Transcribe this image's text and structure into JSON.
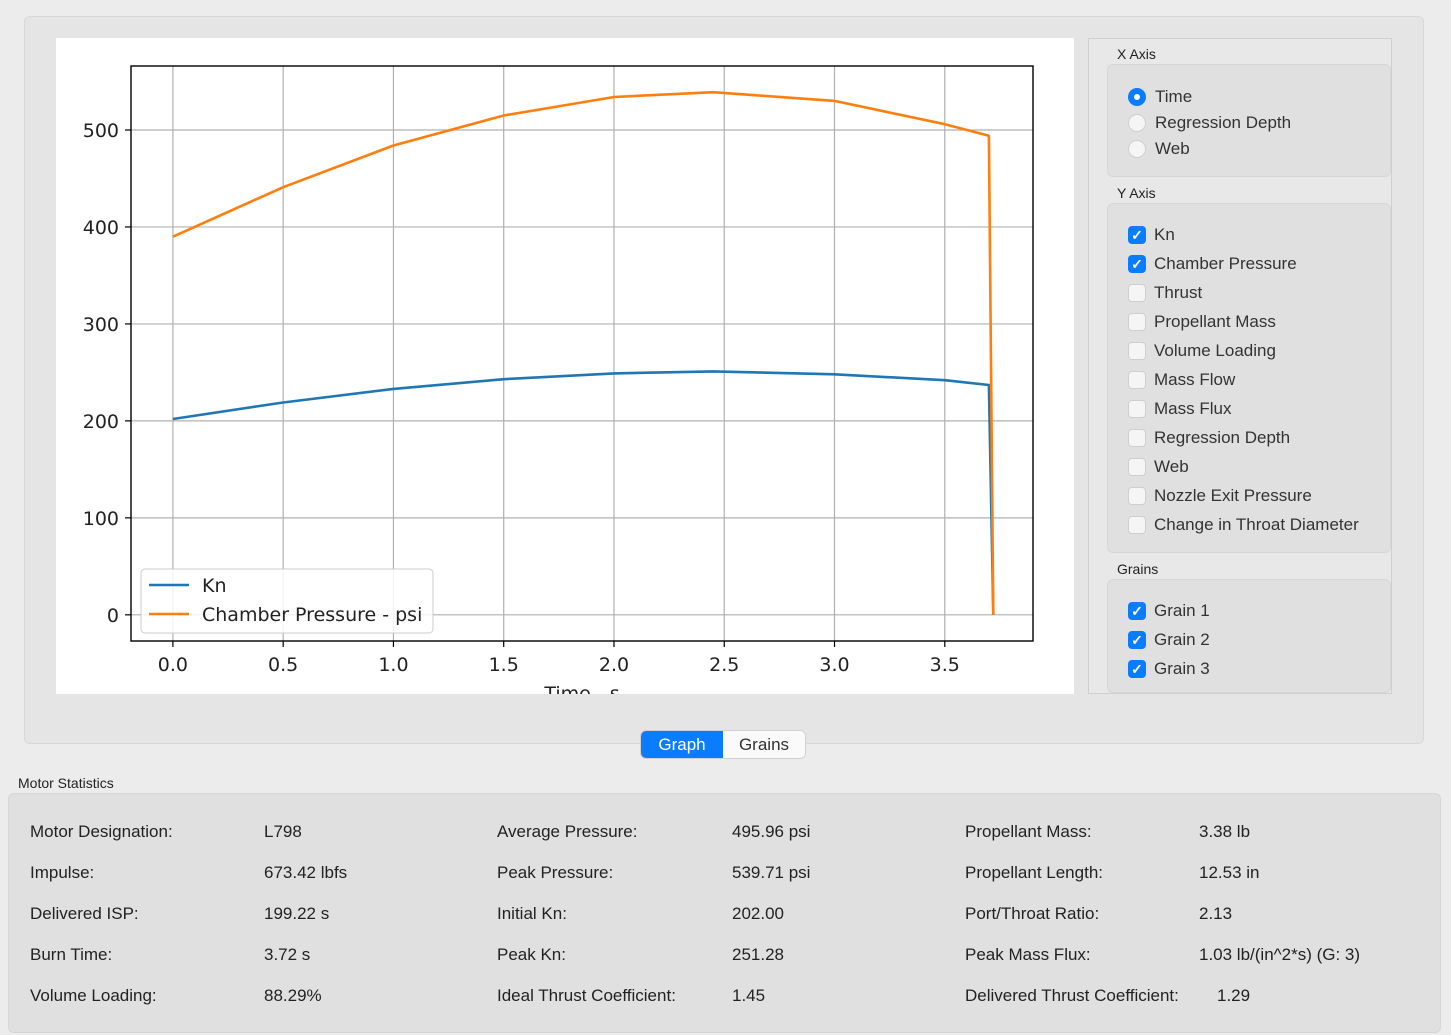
{
  "x_axis": {
    "title": "X Axis",
    "options": [
      {
        "label": "Time",
        "selected": true
      },
      {
        "label": "Regression Depth",
        "selected": false
      },
      {
        "label": "Web",
        "selected": false
      }
    ]
  },
  "y_axis": {
    "title": "Y Axis",
    "options": [
      {
        "label": "Kn",
        "checked": true
      },
      {
        "label": "Chamber Pressure",
        "checked": true
      },
      {
        "label": "Thrust",
        "checked": false
      },
      {
        "label": "Propellant Mass",
        "checked": false
      },
      {
        "label": "Volume Loading",
        "checked": false
      },
      {
        "label": "Mass Flow",
        "checked": false
      },
      {
        "label": "Mass Flux",
        "checked": false
      },
      {
        "label": "Regression Depth",
        "checked": false
      },
      {
        "label": "Web",
        "checked": false
      },
      {
        "label": "Nozzle Exit Pressure",
        "checked": false
      },
      {
        "label": "Change in Throat Diameter",
        "checked": false
      }
    ]
  },
  "grains": {
    "title": "Grains",
    "options": [
      {
        "label": "Grain 1",
        "checked": true
      },
      {
        "label": "Grain 2",
        "checked": true
      },
      {
        "label": "Grain 3",
        "checked": true
      }
    ]
  },
  "tabs": [
    {
      "label": "Graph",
      "active": true
    },
    {
      "label": "Grains",
      "active": false
    }
  ],
  "stats": {
    "title": "Motor Statistics",
    "columns": [
      [
        {
          "label": "Motor Designation:",
          "value": "L798"
        },
        {
          "label": "Impulse:",
          "value": "673.42 lbfs"
        },
        {
          "label": "Delivered ISP:",
          "value": "199.22 s"
        },
        {
          "label": "Burn Time:",
          "value": "3.72 s"
        },
        {
          "label": "Volume Loading:",
          "value": "88.29%"
        }
      ],
      [
        {
          "label": "Average Pressure:",
          "value": "495.96 psi"
        },
        {
          "label": "Peak Pressure:",
          "value": "539.71 psi"
        },
        {
          "label": "Initial Kn:",
          "value": "202.00"
        },
        {
          "label": "Peak Kn:",
          "value": "251.28"
        },
        {
          "label": "Ideal Thrust Coefficient:",
          "value": "1.45"
        }
      ],
      [
        {
          "label": "Propellant Mass:",
          "value": "3.38 lb"
        },
        {
          "label": "Propellant Length:",
          "value": "12.53 in"
        },
        {
          "label": "Port/Throat Ratio:",
          "value": "2.13"
        },
        {
          "label": "Peak Mass Flux:",
          "value": "1.03 lb/(in^2*s) (G: 3)"
        },
        {
          "label": "Delivered Thrust Coefficient:",
          "value": "1.29"
        }
      ]
    ]
  },
  "chart_data": {
    "type": "line",
    "xlabel": "Time - s",
    "ylabel": "",
    "xlim": [
      -0.19,
      3.9
    ],
    "ylim": [
      -27,
      566
    ],
    "xticks": [
      0.0,
      0.5,
      1.0,
      1.5,
      2.0,
      2.5,
      3.0,
      3.5
    ],
    "yticks": [
      0,
      100,
      200,
      300,
      400,
      500
    ],
    "grid": true,
    "legend_position": "lower-left",
    "series": [
      {
        "name": "Kn",
        "color": "#1f77b4",
        "x": [
          0.0,
          0.5,
          1.0,
          1.5,
          2.0,
          2.45,
          3.0,
          3.5,
          3.7,
          3.72
        ],
        "y": [
          202,
          219,
          233,
          243,
          249,
          251,
          248,
          242,
          237,
          0
        ]
      },
      {
        "name": "Chamber Pressure - psi",
        "color": "#ff7f0e",
        "x": [
          0.0,
          0.5,
          1.0,
          1.5,
          2.0,
          2.45,
          3.0,
          3.5,
          3.7,
          3.72
        ],
        "y": [
          390,
          441,
          484,
          515,
          534,
          539,
          530,
          506,
          494,
          0
        ]
      }
    ]
  }
}
